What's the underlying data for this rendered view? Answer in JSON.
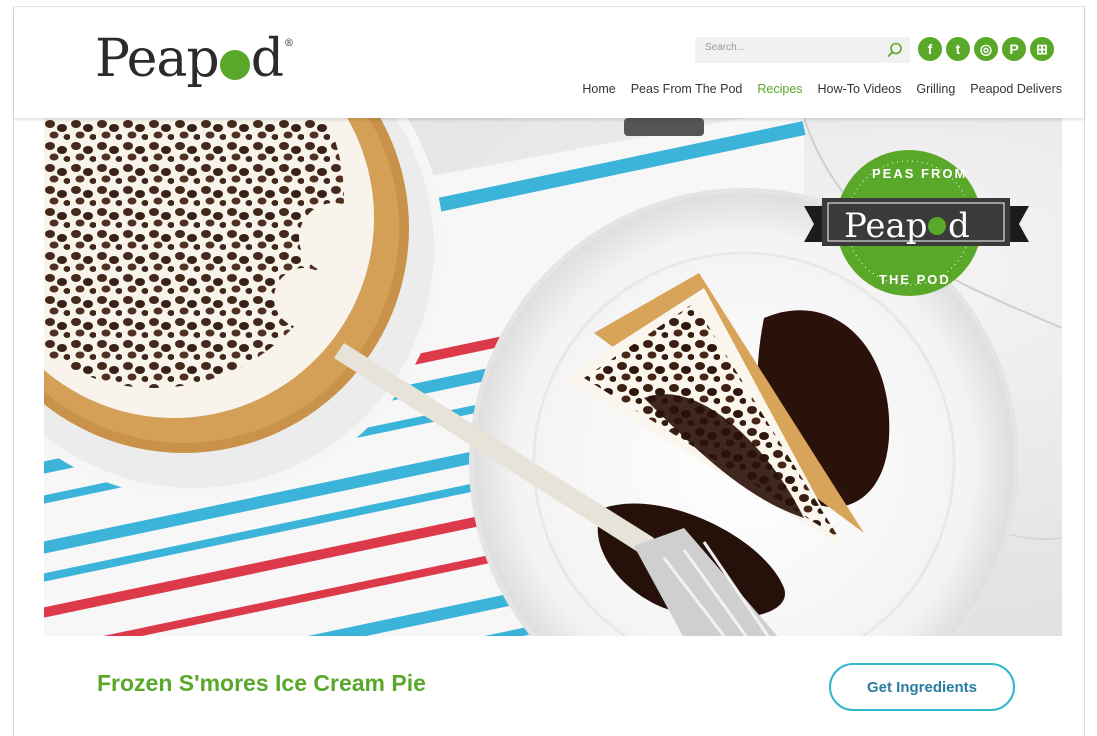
{
  "brand": {
    "name_left": "Peap",
    "name_right": "d",
    "reg": "®"
  },
  "search": {
    "placeholder": "Search..."
  },
  "socials": [
    {
      "icon": "facebook-icon",
      "glyph": "f"
    },
    {
      "icon": "twitter-icon",
      "glyph": "t"
    },
    {
      "icon": "instagram-icon",
      "glyph": "◎"
    },
    {
      "icon": "pinterest-icon",
      "glyph": "P"
    },
    {
      "icon": "cart-icon",
      "glyph": "⊞"
    }
  ],
  "nav": [
    {
      "label": "Home",
      "active": false
    },
    {
      "label": "Peas From The Pod",
      "active": false
    },
    {
      "label": "Recipes",
      "active": true
    },
    {
      "label": "How-To Videos",
      "active": false
    },
    {
      "label": "Grilling",
      "active": false
    },
    {
      "label": "Peapod Delivers",
      "active": false
    }
  ],
  "badge": {
    "top_text": "PEAS FROM",
    "bottom_text": "THE POD",
    "name_left": "Peap",
    "name_right": "d",
    "reg": "®"
  },
  "recipe": {
    "title": "Frozen S'mores Ice Cream Pie"
  },
  "cta": {
    "label": "Get Ingredients"
  },
  "colors": {
    "brand_green": "#5aa829",
    "cta_border": "#2fb8c8",
    "cta_text": "#2a7da1"
  }
}
